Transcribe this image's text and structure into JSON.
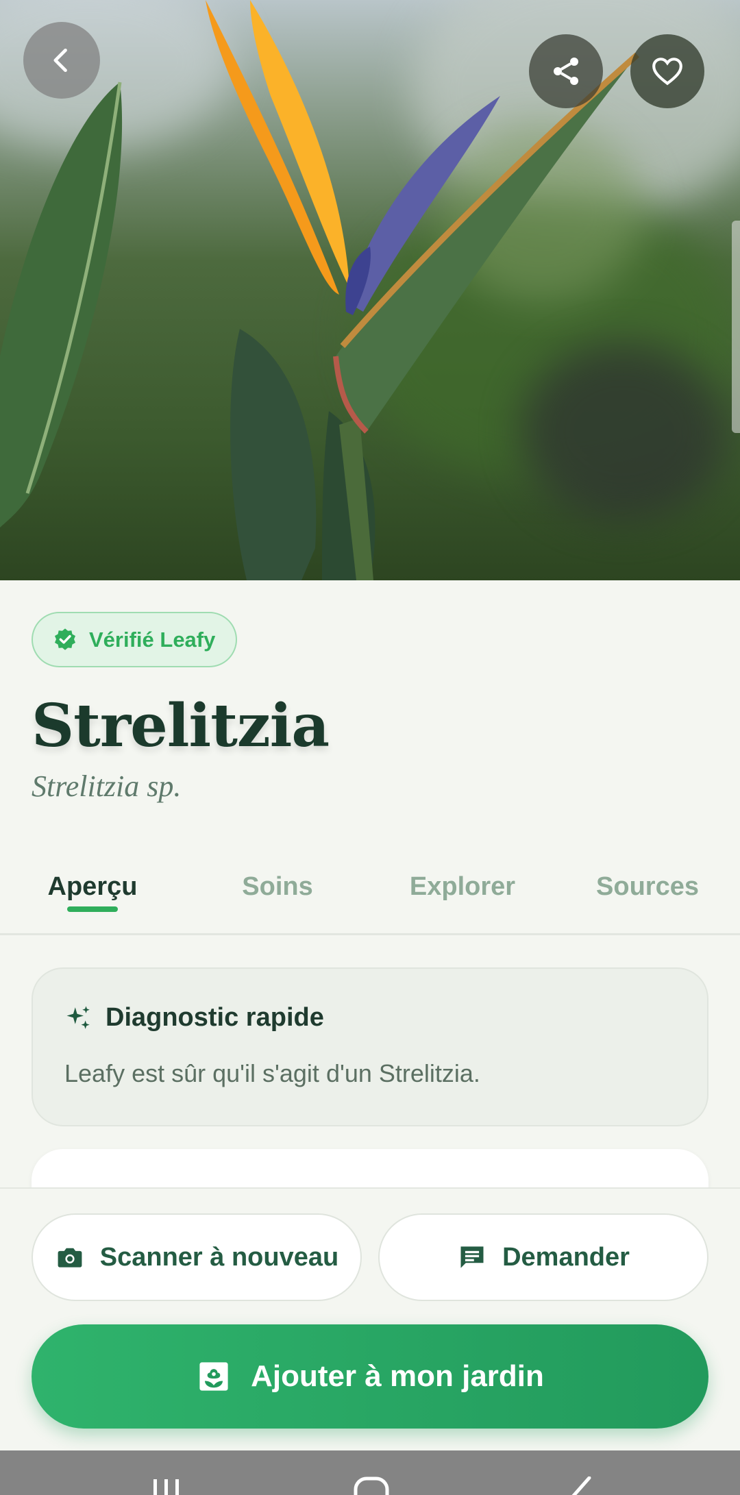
{
  "hero": {
    "back_icon": "chevron-left-icon",
    "share_icon": "share-icon",
    "favorite_icon": "heart-outline-icon"
  },
  "badge": {
    "icon": "verified-check-icon",
    "label": "Vérifié Leafy",
    "color": "#2fae5b"
  },
  "plant": {
    "name": "Strelitzia",
    "scientific_name": "Strelitzia sp."
  },
  "tabs": [
    {
      "label": "Aperçu",
      "active": true
    },
    {
      "label": "Soins",
      "active": false
    },
    {
      "label": "Explorer",
      "active": false
    },
    {
      "label": "Sources",
      "active": false
    }
  ],
  "diagnostic": {
    "icon": "sparkles-icon",
    "title": "Diagnostic rapide",
    "text": "Leafy est sûr qu'il s'agit d'un Strelitzia."
  },
  "actions": {
    "scan": {
      "icon": "camera-icon",
      "label": "Scanner à nouveau"
    },
    "ask": {
      "icon": "chat-icon",
      "label": "Demander"
    },
    "add": {
      "icon": "garden-add-icon",
      "label": "Ajouter à mon jardin"
    }
  },
  "colors": {
    "accent": "#2fae5b",
    "primary_dark": "#1b3a2c",
    "background": "#f4f6f1"
  },
  "system_nav": {
    "recents_icon": "recents-icon",
    "home_icon": "home-icon",
    "back_icon": "back-icon"
  }
}
